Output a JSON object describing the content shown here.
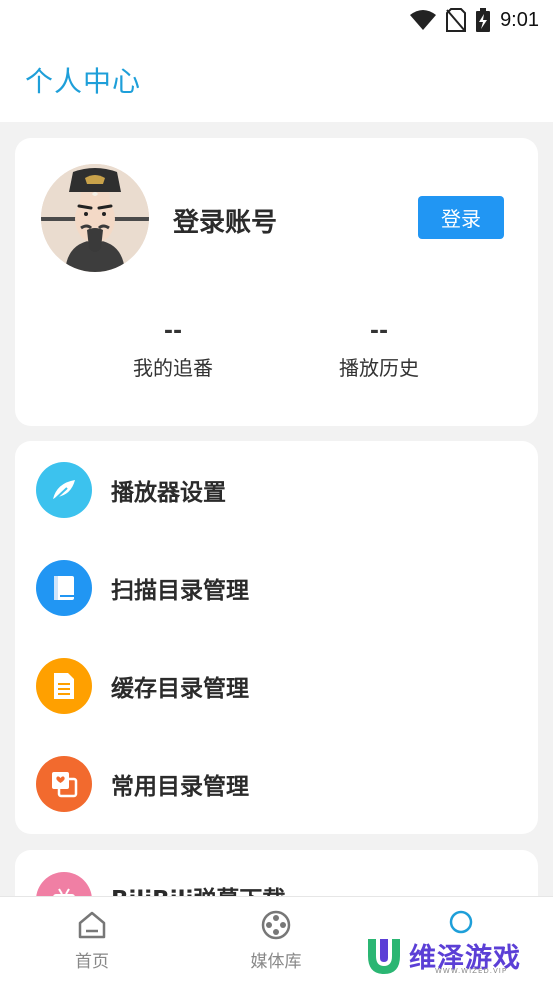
{
  "status_bar": {
    "time": "9:01"
  },
  "header": {
    "title": "个人中心"
  },
  "profile": {
    "account_label": "登录账号",
    "login_button": "登录",
    "stats": [
      {
        "value": "--",
        "label": "我的追番"
      },
      {
        "value": "--",
        "label": "播放历史"
      }
    ]
  },
  "menu": {
    "items": [
      {
        "label": "播放器设置",
        "icon": "feather-icon",
        "color": "#3cc2ee"
      },
      {
        "label": "扫描目录管理",
        "icon": "book-icon",
        "color": "#2196f3"
      },
      {
        "label": "缓存目录管理",
        "icon": "document-icon",
        "color": "#ffa000"
      },
      {
        "label": "常用目录管理",
        "icon": "folder-heart-icon",
        "color": "#f26a2e"
      }
    ],
    "partial_item": {
      "label": "BiliBili弹幕下载",
      "icon": "bilibili-icon",
      "color": "#f07fa4"
    }
  },
  "bottom_nav": {
    "items": [
      {
        "label": "首页",
        "icon": "home-icon"
      },
      {
        "label": "媒体库",
        "icon": "film-reel-icon"
      },
      {
        "label": "",
        "icon": "profile-circle-icon"
      }
    ],
    "active_color": "#1e9fd9"
  },
  "watermark": {
    "text": "维泽游戏",
    "sub": "WWW.WIZED.VIP"
  },
  "colors": {
    "accent": "#1e9fd9",
    "button": "#2196f3"
  }
}
